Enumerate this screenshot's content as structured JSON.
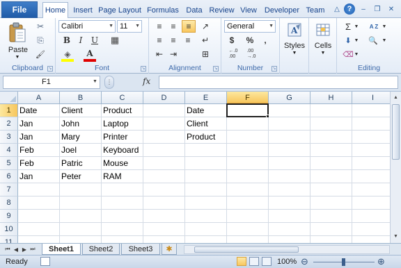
{
  "ribbon_tabs": {
    "file": "File",
    "items": [
      "Home",
      "Insert",
      "Page Layout",
      "Formulas",
      "Data",
      "Review",
      "View",
      "Developer",
      "Team"
    ],
    "active": "Home"
  },
  "window_controls": {
    "collapse": "△",
    "help": "?",
    "minimize": "–",
    "restore": "❐",
    "close": "✕"
  },
  "ribbon": {
    "clipboard": {
      "label": "Clipboard",
      "paste": "Paste",
      "cut_icon": "✂",
      "copy_icon": "⎘",
      "format_painter_icon": "🖌"
    },
    "font": {
      "label": "Font",
      "font_name": "Calibri",
      "font_size": "11",
      "grow": "A",
      "shrink": "A",
      "bold": "B",
      "italic": "I",
      "underline": "U",
      "borders_icon": "▦",
      "fill_icon": "◈",
      "fill_color": "#ffff00",
      "font_color_letter": "A",
      "font_color": "#e00000"
    },
    "alignment": {
      "label": "Alignment",
      "top_align": "≡",
      "middle_align": "≡",
      "bottom_align": "≡",
      "align_left": "≡",
      "align_center": "≡",
      "align_right": "≡",
      "decrease_indent": "⇤",
      "increase_indent": "⇥",
      "orientation": "↗",
      "wrap_text": "↵",
      "merge": "⊞"
    },
    "number": {
      "label": "Number",
      "format": "General",
      "currency": "$",
      "percent": "%",
      "comma": ",",
      "inc_decimal": "←.0\n.00",
      "dec_decimal": ".00\n→.0"
    },
    "styles": {
      "label": "Styles"
    },
    "cells": {
      "label": "Cells"
    },
    "editing": {
      "label": "Editing",
      "sum": "Σ",
      "fill": "⬇",
      "clear": "⌫",
      "sort": "A Z",
      "find": "🔍"
    }
  },
  "formula_bar": {
    "name_box": "F1",
    "fx": "fx",
    "formula": ""
  },
  "columns": [
    "A",
    "B",
    "C",
    "D",
    "E",
    "F",
    "G",
    "H",
    "I"
  ],
  "rows": [
    "1",
    "2",
    "3",
    "4",
    "5",
    "6",
    "7",
    "8",
    "9",
    "10",
    "11"
  ],
  "active_cell": "F1",
  "cells": {
    "A1": "Date",
    "B1": "Client",
    "C1": "Product",
    "E1": "Date",
    "A2": "Jan",
    "B2": "John",
    "C2": "Laptop",
    "E2": "Client",
    "A3": "Jan",
    "B3": "Mary",
    "C3": "Printer",
    "E3": "Product",
    "A4": "Feb",
    "B4": "Joel",
    "C4": "Keyboard",
    "A5": "Feb",
    "B5": "Patric",
    "C5": "Mouse",
    "A6": "Jan",
    "B6": "Peter",
    "C6": "RAM"
  },
  "sheets": {
    "tabs": [
      "Sheet1",
      "Sheet2",
      "Sheet3"
    ],
    "active": "Sheet1",
    "nav": [
      "⏮",
      "◀",
      "▶",
      "⏭"
    ],
    "insert_icon": "✱"
  },
  "status_bar": {
    "status": "Ready",
    "zoom": "100%",
    "zoom_out": "⊖",
    "zoom_in": "⊕"
  }
}
